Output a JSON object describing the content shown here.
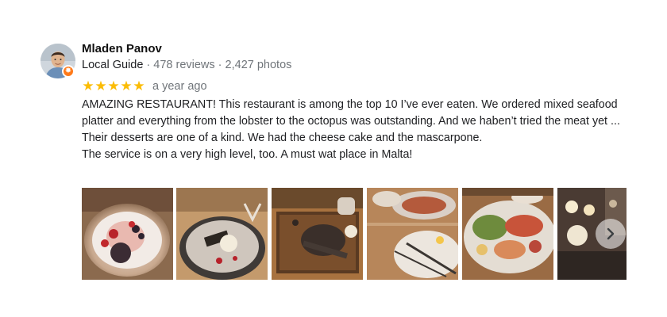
{
  "review": {
    "author": "Mladen Panov",
    "meta": {
      "role": "Local Guide",
      "separator": " · ",
      "reviews": "478 reviews",
      "photos": "2,427 photos"
    },
    "rating": 5,
    "rating_max": 5,
    "star_char": "★",
    "date": "a year ago",
    "text_lines": [
      "AMAZING RESTAURANT! This restaurant is among the top 10 I’ve ever eaten. We ordered mixed seafood platter and everything from the lobster to the octopus was outstanding. And we haben’t tried the meat yet ...",
      "Their desserts are one of a kind. We had the cheese cake and the mascarpone.",
      "The service is on a very high level, too. A must wat place in Malta!"
    ]
  },
  "icons": {
    "local_guide_badge": "star-badge-icon",
    "next_photos": "chevron-right-icon"
  },
  "colors": {
    "star": "#fbbc04",
    "badge": "#ff7a1a",
    "meta_text": "#70757a"
  }
}
